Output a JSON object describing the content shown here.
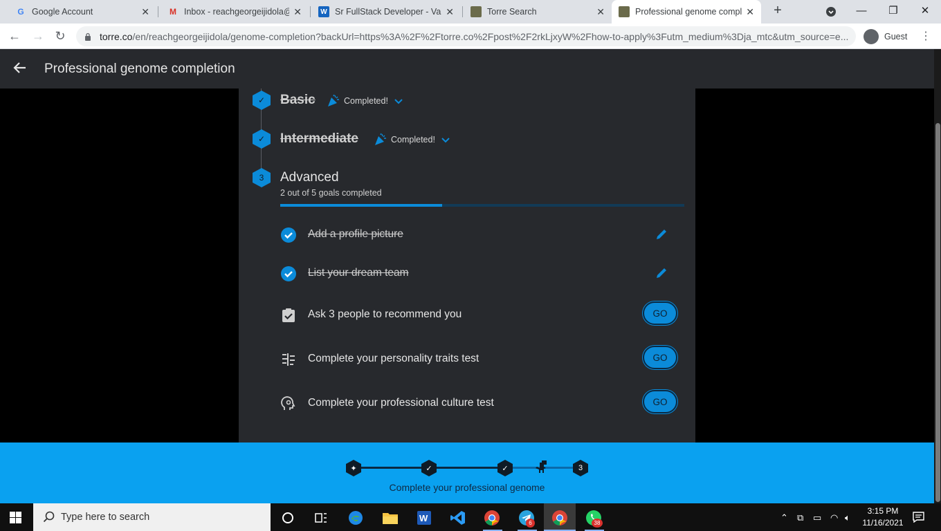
{
  "browser": {
    "tabs": [
      {
        "title": "Google Account",
        "favicon": "google-g-icon"
      },
      {
        "title": "Inbox - reachgeorgeijidola@g",
        "favicon": "gmail-icon"
      },
      {
        "title": "Sr FullStack Developer - VanH",
        "favicon": "vanhack-icon"
      },
      {
        "title": "Torre Search",
        "favicon": "torre-icon"
      },
      {
        "title": "Professional genome comple",
        "favicon": "torre-icon"
      }
    ],
    "active_tab_index": 4,
    "url_host": "torre.co",
    "url_rest": "/en/reachgeorgeijidola/genome-completion?backUrl=https%3A%2F%2Ftorre.co%2Fpost%2F2rkLjxyW%2Fhow-to-apply%3Futm_medium%3Dja_mtc&utm_source=e...",
    "profile_label": "Guest"
  },
  "app": {
    "header_title": "Professional genome completion",
    "levels": [
      {
        "title": "Basic",
        "status": "Completed!",
        "done": true
      },
      {
        "title": "Intermediate",
        "status": "Completed!",
        "done": true
      },
      {
        "title": "Advanced",
        "number": "3",
        "done": false
      }
    ],
    "advanced_summary": "2 out of 5 goals completed",
    "progress_fraction": 0.4,
    "goals": [
      {
        "label": "Add a profile picture",
        "done": true,
        "icon": "check-circle-icon",
        "action": "edit"
      },
      {
        "label": "List your dream team",
        "done": true,
        "icon": "check-circle-icon",
        "action": "edit"
      },
      {
        "label": "Ask 3 people to recommend you",
        "done": false,
        "icon": "clipboard-check-icon",
        "action": "GO"
      },
      {
        "label": "Complete your personality traits test",
        "done": false,
        "icon": "traits-icon",
        "action": "GO"
      },
      {
        "label": "Complete your professional culture test",
        "done": false,
        "icon": "head-gear-icon",
        "action": "GO"
      }
    ],
    "banner_caption": "Complete your professional genome",
    "banner_current_step": "3"
  },
  "taskbar": {
    "search_placeholder": "Type here to search",
    "time": "3:15 PM",
    "date": "11/16/2021",
    "telegram_badge": "6",
    "whatsapp_badge": "38"
  },
  "colors": {
    "accent": "#0b8bd9",
    "banner": "#0aa1f0",
    "card": "#27292d"
  }
}
